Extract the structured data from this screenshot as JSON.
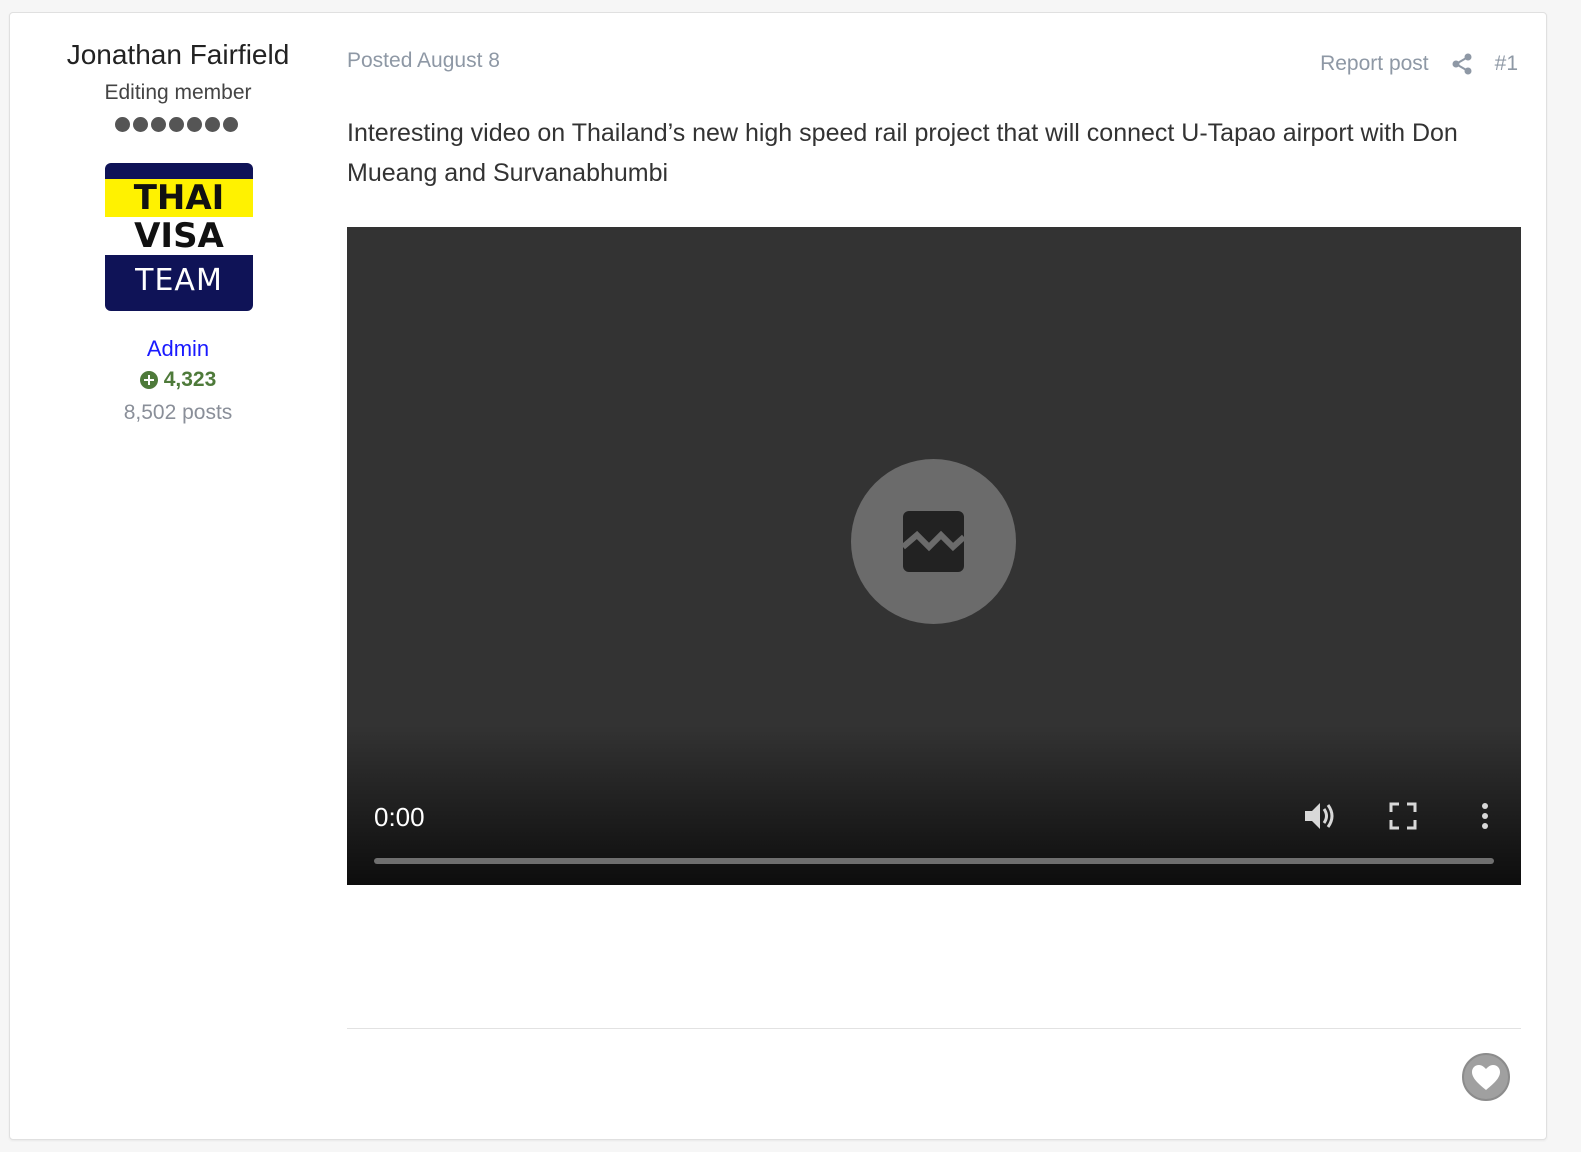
{
  "author": {
    "name": "Jonathan Fairfield",
    "title": "Editing member",
    "rank_pips": 7,
    "avatar": {
      "line1": "THAI",
      "line2": "VISA",
      "line3": "TEAM"
    },
    "group": "Admin",
    "reputation": "4,323",
    "posts": "8,502 posts"
  },
  "post": {
    "posted": "Posted August 8",
    "report_label": "Report post",
    "post_number": "#1",
    "body": "Interesting video on Thailand’s new high speed rail project that will connect U-Tapao airport with Don Mueang and Survanabhumbi"
  },
  "video": {
    "time": "0:00",
    "progress": 0
  },
  "colors": {
    "group_link": "#1a1aff",
    "reputation": "#4e7a3a",
    "meta_text": "#8e98a5",
    "video_bg": "#333333"
  },
  "icons": {
    "broken_image": "broken-image-icon",
    "share": "share-icon",
    "mute": "volume-icon",
    "fullscreen": "fullscreen-icon",
    "more": "more-vertical-icon",
    "like": "heart-icon",
    "reputation": "plus-circle-icon"
  }
}
